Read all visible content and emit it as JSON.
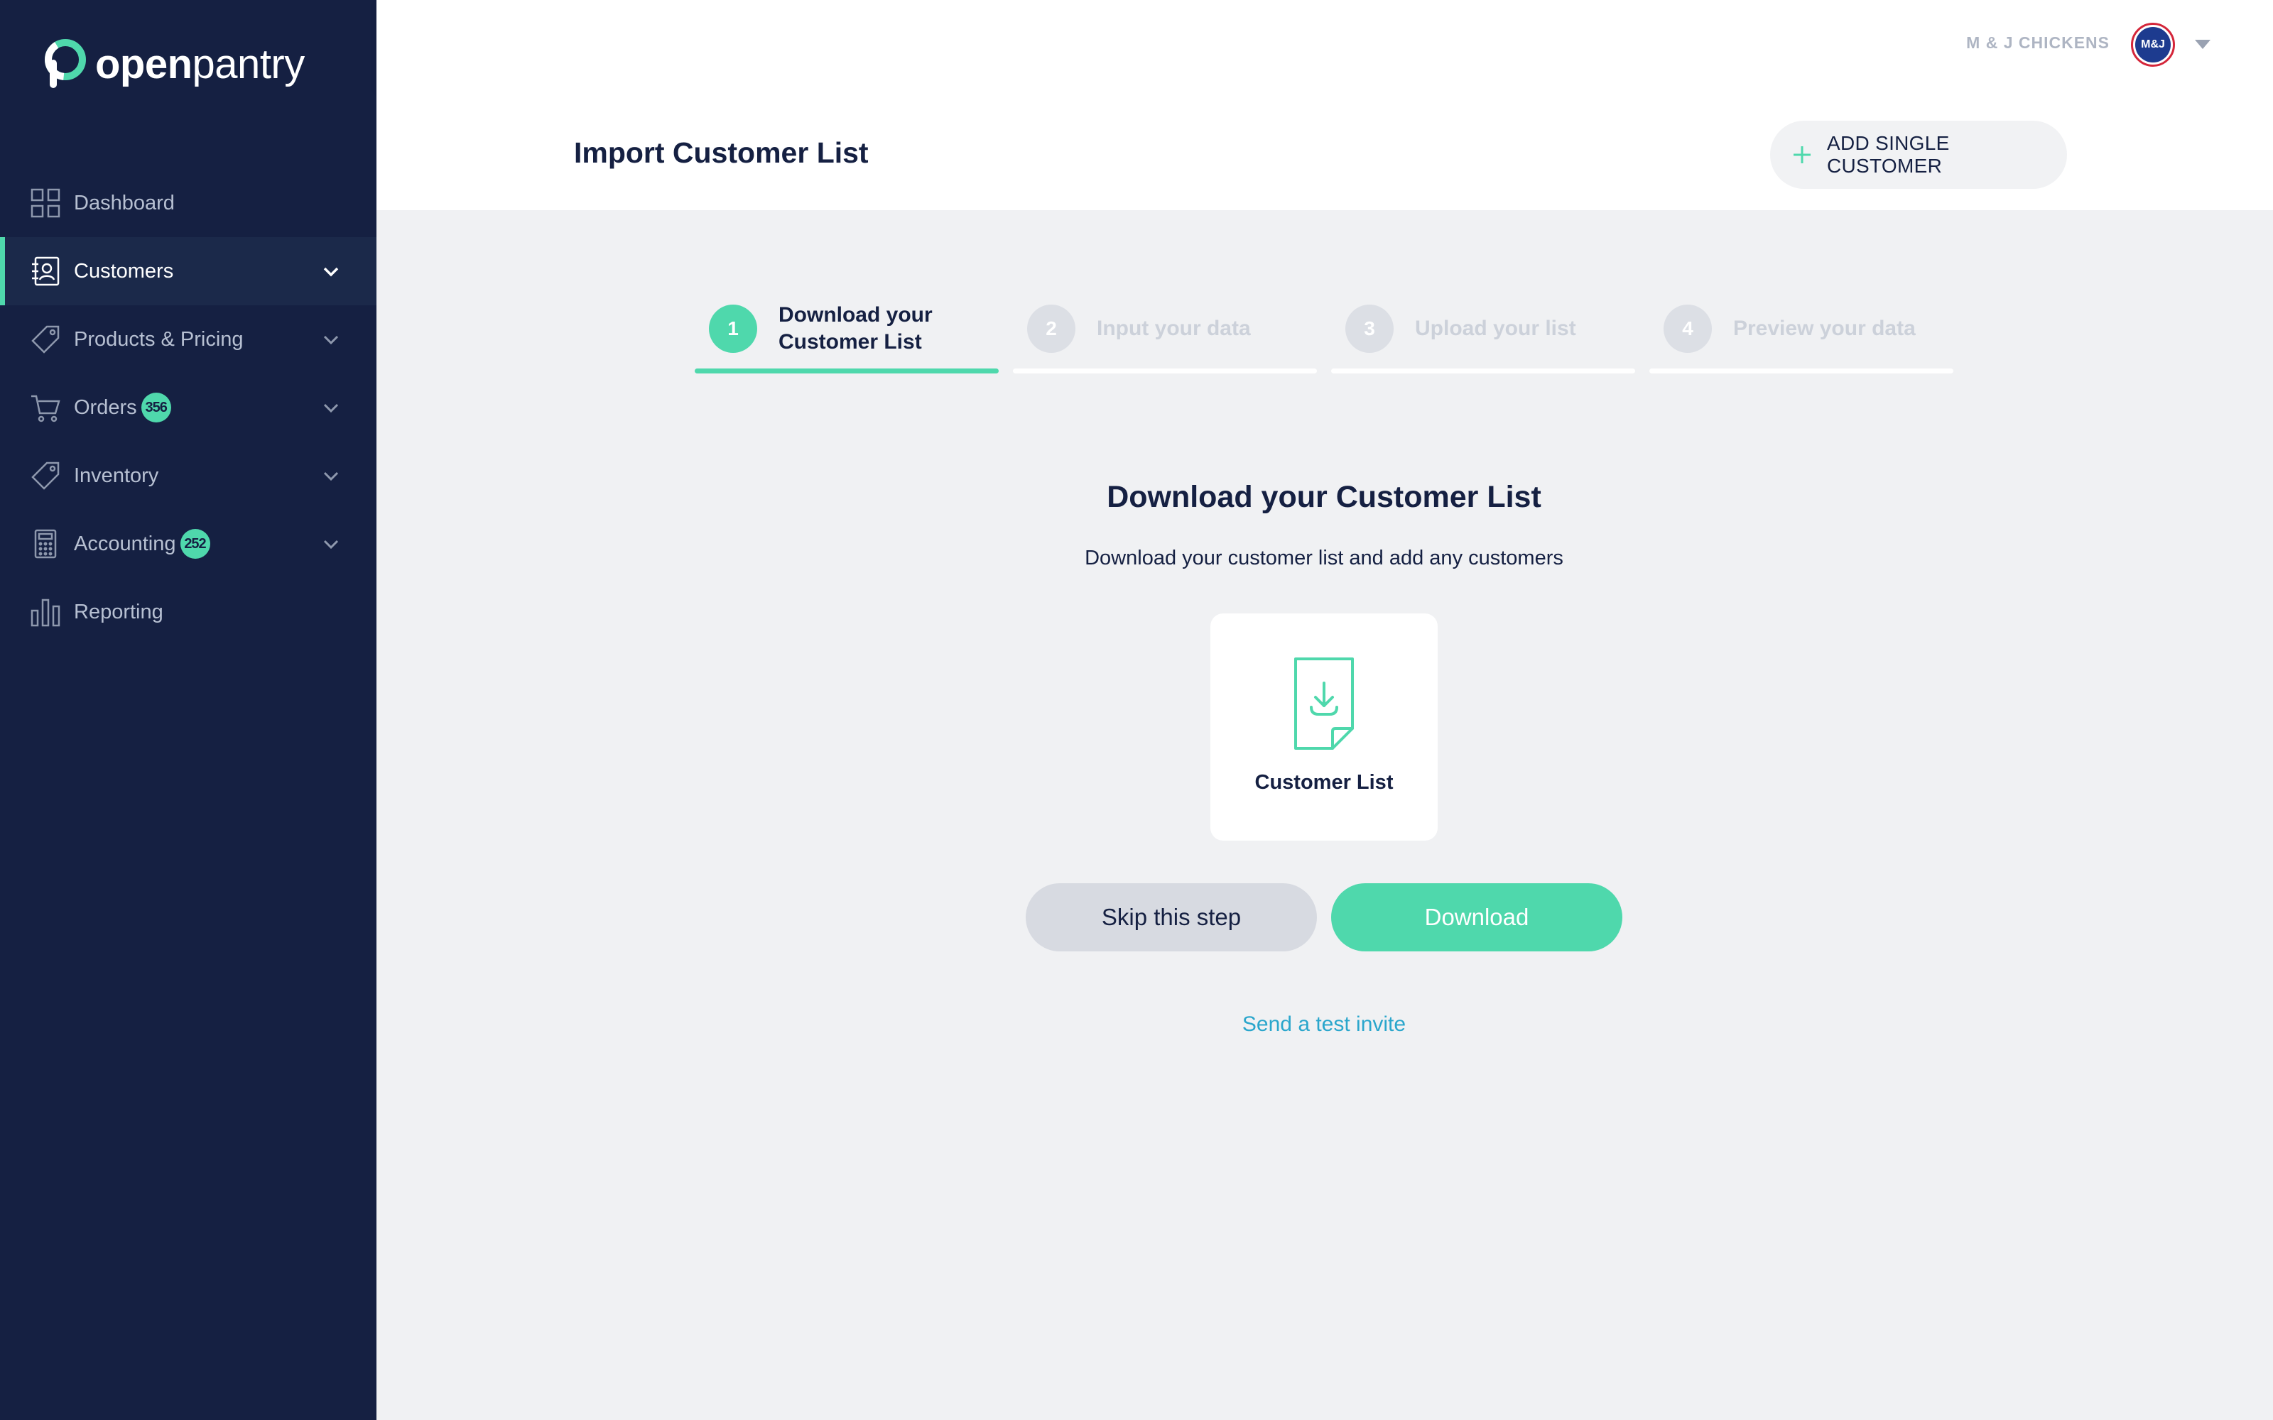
{
  "brand": {
    "logo_text_bold": "open",
    "logo_text_light": "pantry",
    "accent": "#4fd8ac",
    "sidebar_bg": "#152042"
  },
  "sidebar": {
    "items": [
      {
        "label": "Dashboard",
        "icon": "dashboard-grid-icon",
        "badge": null,
        "chevron": false,
        "active": false
      },
      {
        "label": "Customers",
        "icon": "contacts-book-icon",
        "badge": null,
        "chevron": true,
        "active": true
      },
      {
        "label": "Products & Pricing",
        "icon": "price-tag-icon",
        "badge": null,
        "chevron": true,
        "active": false
      },
      {
        "label": "Orders",
        "icon": "cart-icon",
        "badge": "356",
        "chevron": true,
        "active": false
      },
      {
        "label": "Inventory",
        "icon": "tag-icon",
        "badge": null,
        "chevron": true,
        "active": false
      },
      {
        "label": "Accounting",
        "icon": "calculator-icon",
        "badge": "252",
        "chevron": true,
        "active": false
      },
      {
        "label": "Reporting",
        "icon": "bar-chart-icon",
        "badge": null,
        "chevron": false,
        "active": false
      }
    ]
  },
  "topbar": {
    "company": "M & J CHICKENS",
    "avatar_text": "M&J"
  },
  "header": {
    "title": "Import Customer List",
    "add_button": "ADD SINGLE CUSTOMER"
  },
  "stepper": {
    "steps": [
      {
        "num": "1",
        "label": "Download your Customer List",
        "active": true
      },
      {
        "num": "2",
        "label": "Input your data",
        "active": false
      },
      {
        "num": "3",
        "label": "Upload your list",
        "active": false
      },
      {
        "num": "4",
        "label": "Preview your data",
        "active": false
      }
    ]
  },
  "content": {
    "title": "Download your Customer List",
    "subtitle": "Download your customer list and add any customers",
    "card_label": "Customer List",
    "skip_button": "Skip this step",
    "download_button": "Download",
    "test_link": "Send a test invite"
  }
}
